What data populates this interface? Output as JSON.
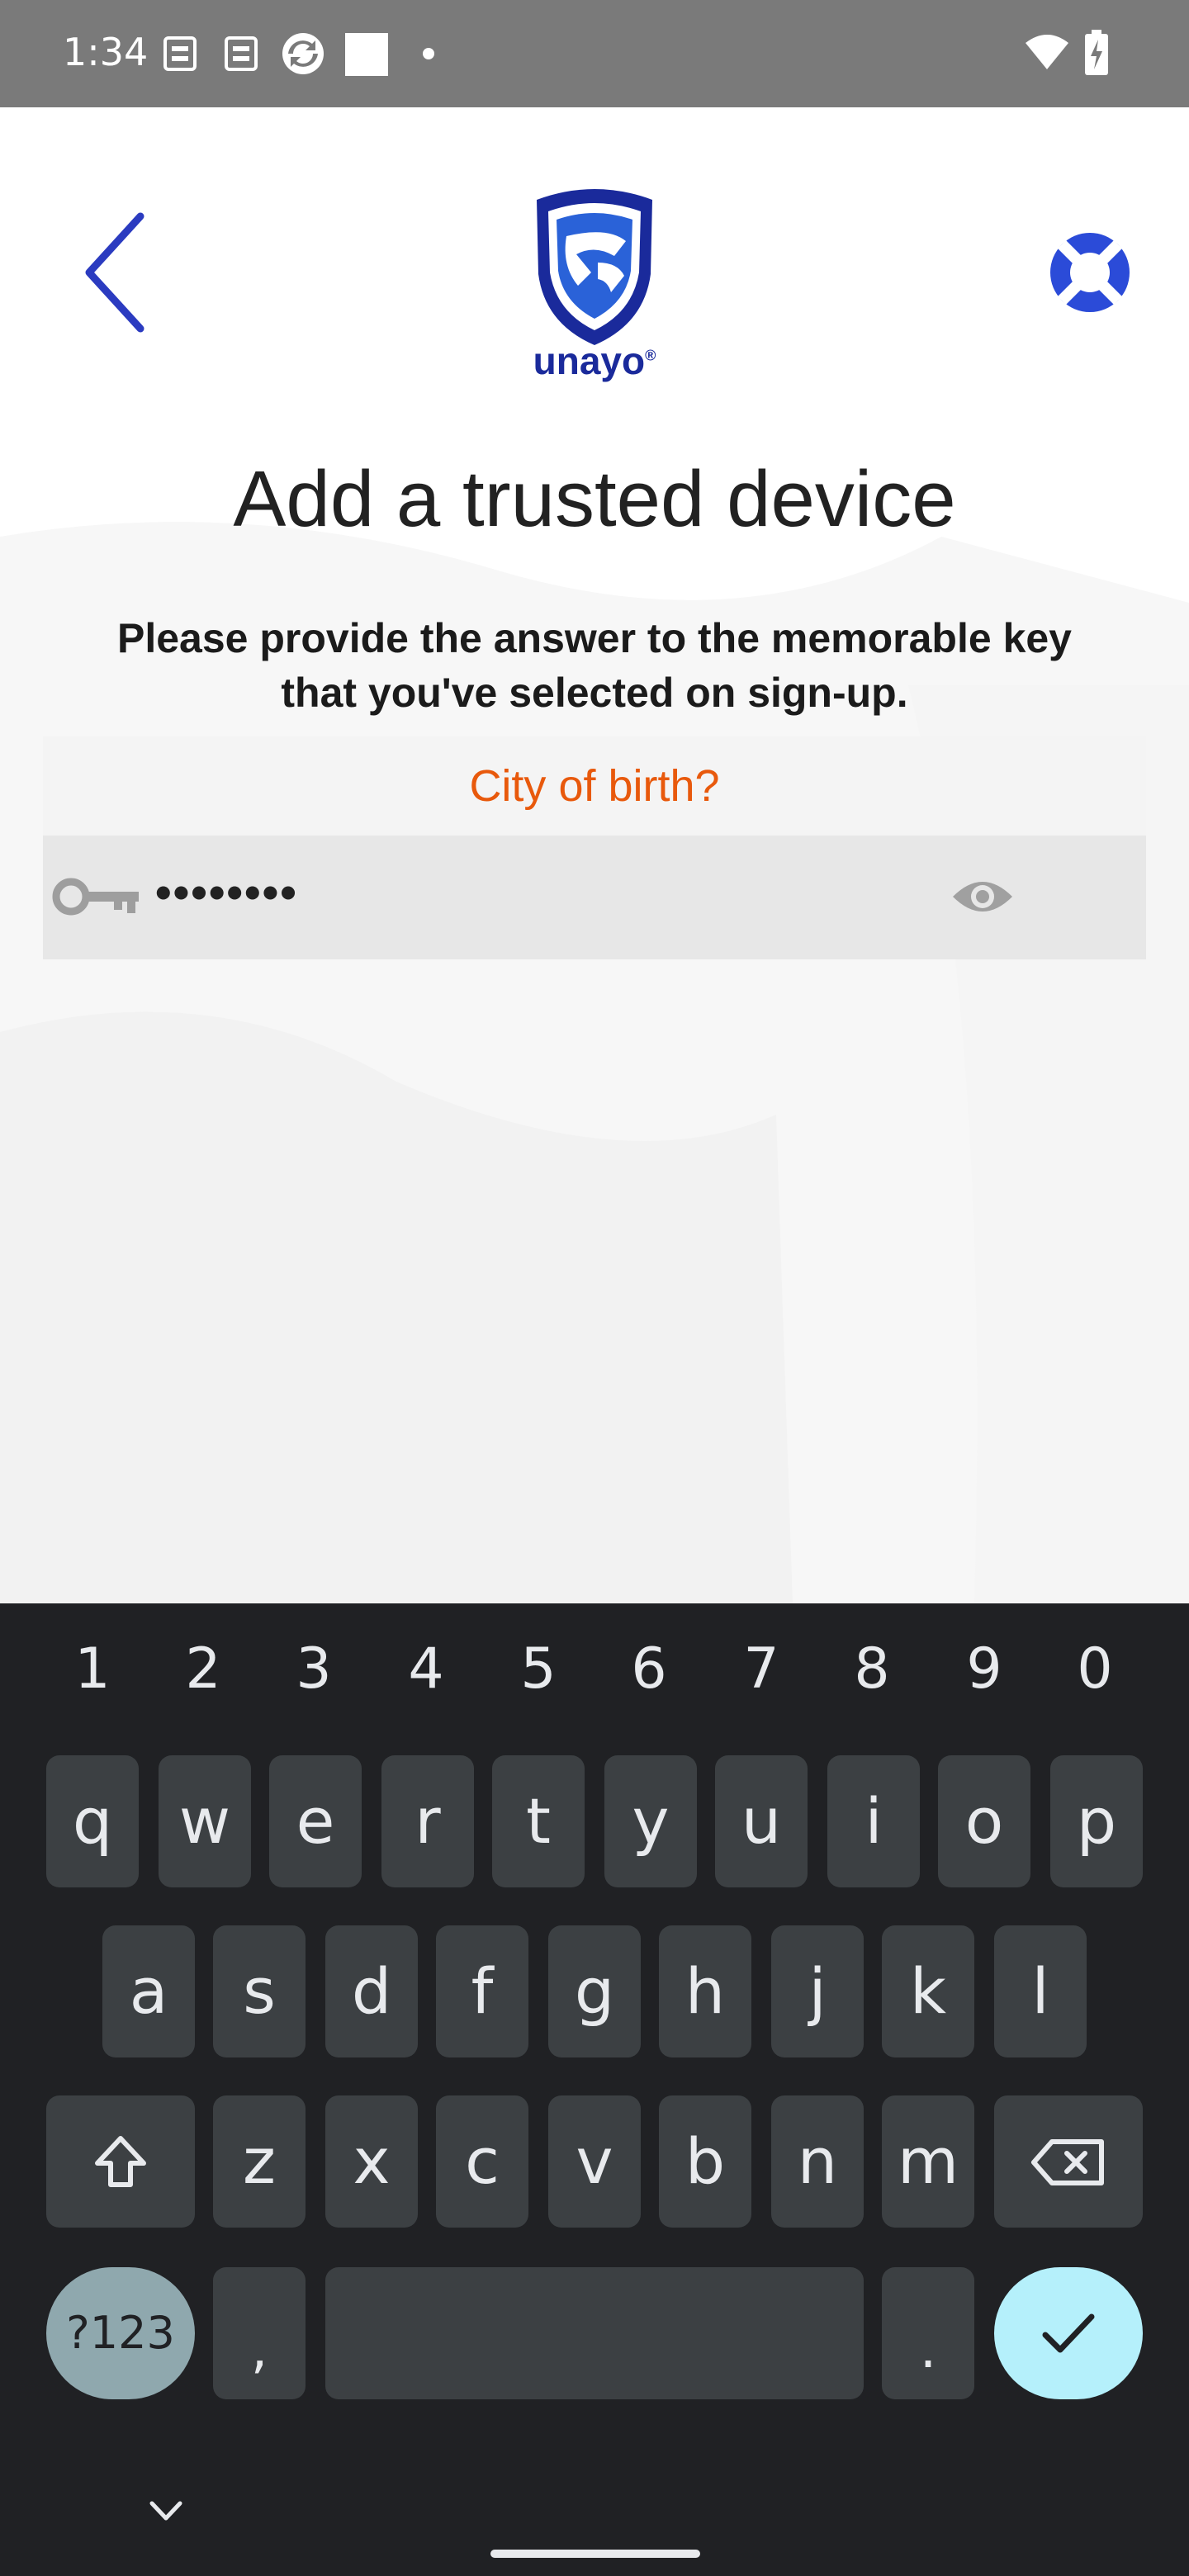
{
  "status_bar": {
    "time": "1:34",
    "icons": [
      "sim-icon",
      "sim-icon",
      "sync-icon",
      "square-icon",
      "dot-icon",
      "wifi-icon",
      "battery-charging-icon"
    ]
  },
  "header": {
    "back_icon": "chevron-left-icon",
    "logo_text": "unayo",
    "logo_mark": "®",
    "help_icon": "lifebuoy-icon",
    "brand_color": "#1a2a9b"
  },
  "main": {
    "title": "Add a trusted device",
    "subtitle_line1": "Please provide the answer to the memorable key",
    "subtitle_line2": "that you've selected on sign-up.",
    "question": "City of birth?",
    "question_color": "#e8590c",
    "answer_value": "••••••••",
    "answer_icon": "key-icon",
    "toggle_icon": "eye-icon"
  },
  "keyboard": {
    "numbers": [
      "1",
      "2",
      "3",
      "4",
      "5",
      "6",
      "7",
      "8",
      "9",
      "0"
    ],
    "row1": [
      "q",
      "w",
      "e",
      "r",
      "t",
      "y",
      "u",
      "i",
      "o",
      "p"
    ],
    "row2": [
      "a",
      "s",
      "d",
      "f",
      "g",
      "h",
      "j",
      "k",
      "l"
    ],
    "row3": [
      "z",
      "x",
      "c",
      "v",
      "b",
      "n",
      "m"
    ],
    "symbols_label": "?123",
    "comma_label": ",",
    "period_label": ".",
    "shift_icon": "shift-icon",
    "backspace_icon": "backspace-icon",
    "enter_icon": "checkmark-icon",
    "hide_icon": "chevron-down-icon"
  }
}
